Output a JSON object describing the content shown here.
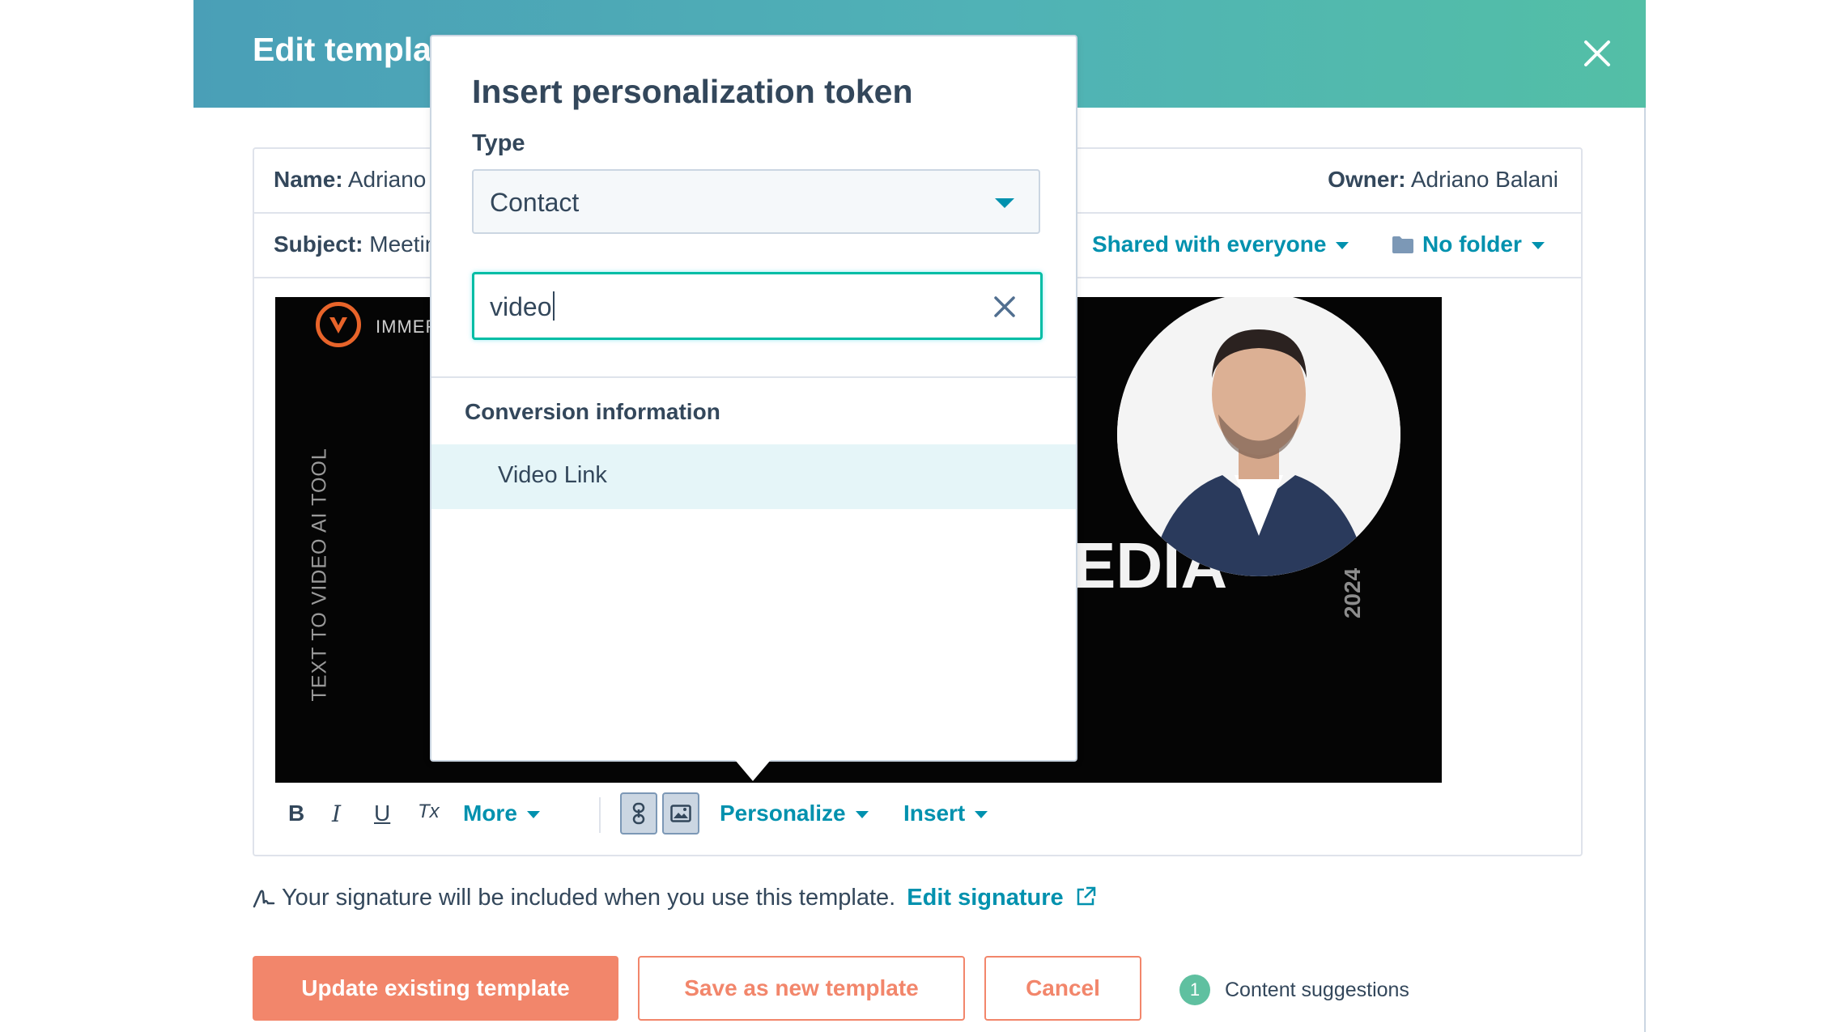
{
  "modal": {
    "title": "Edit template",
    "close_icon": "close-icon"
  },
  "template_fields": {
    "name_label": "Name:",
    "name_value": "Adriano",
    "owner_label": "Owner:",
    "owner_value": "Adriano Balani",
    "subject_label": "Subject:",
    "subject_value": "Meeting",
    "sharing": "Shared with everyone",
    "folder": "No folder",
    "folder_icon": "folder-icon"
  },
  "email_image": {
    "brand_text": "IMMERSIVE",
    "vertical_tag": "TEXT TO VIDEO AI TOOL",
    "big_word": "EDIA",
    "year": "2024"
  },
  "toolbar": {
    "bold": "B",
    "italic": "I",
    "underline": "U",
    "clear_format": "Tx",
    "more": "More",
    "personalize": "Personalize",
    "insert": "Insert"
  },
  "signature": {
    "text": "Your signature will be included when you use this template.",
    "link": "Edit signature"
  },
  "footer": {
    "update_button": "Update existing template",
    "save_new_button": "Save as new template",
    "cancel_button": "Cancel",
    "suggestions_count": "1",
    "suggestions_label": "Content suggestions"
  },
  "popover": {
    "title": "Insert personalization token",
    "type_label": "Type",
    "type_value": "Contact",
    "search_value": "video",
    "group_heading": "Conversion information",
    "results": [
      "Video Link"
    ]
  },
  "colors": {
    "header_gradient_start": "#4a9fb7",
    "header_gradient_end": "#53bfa6",
    "accent_orange": "#f2866b",
    "link_blue": "#0091ae",
    "text_dark": "#33475b",
    "focus_teal": "#00bda5",
    "highlight_row": "#e5f5f8"
  }
}
